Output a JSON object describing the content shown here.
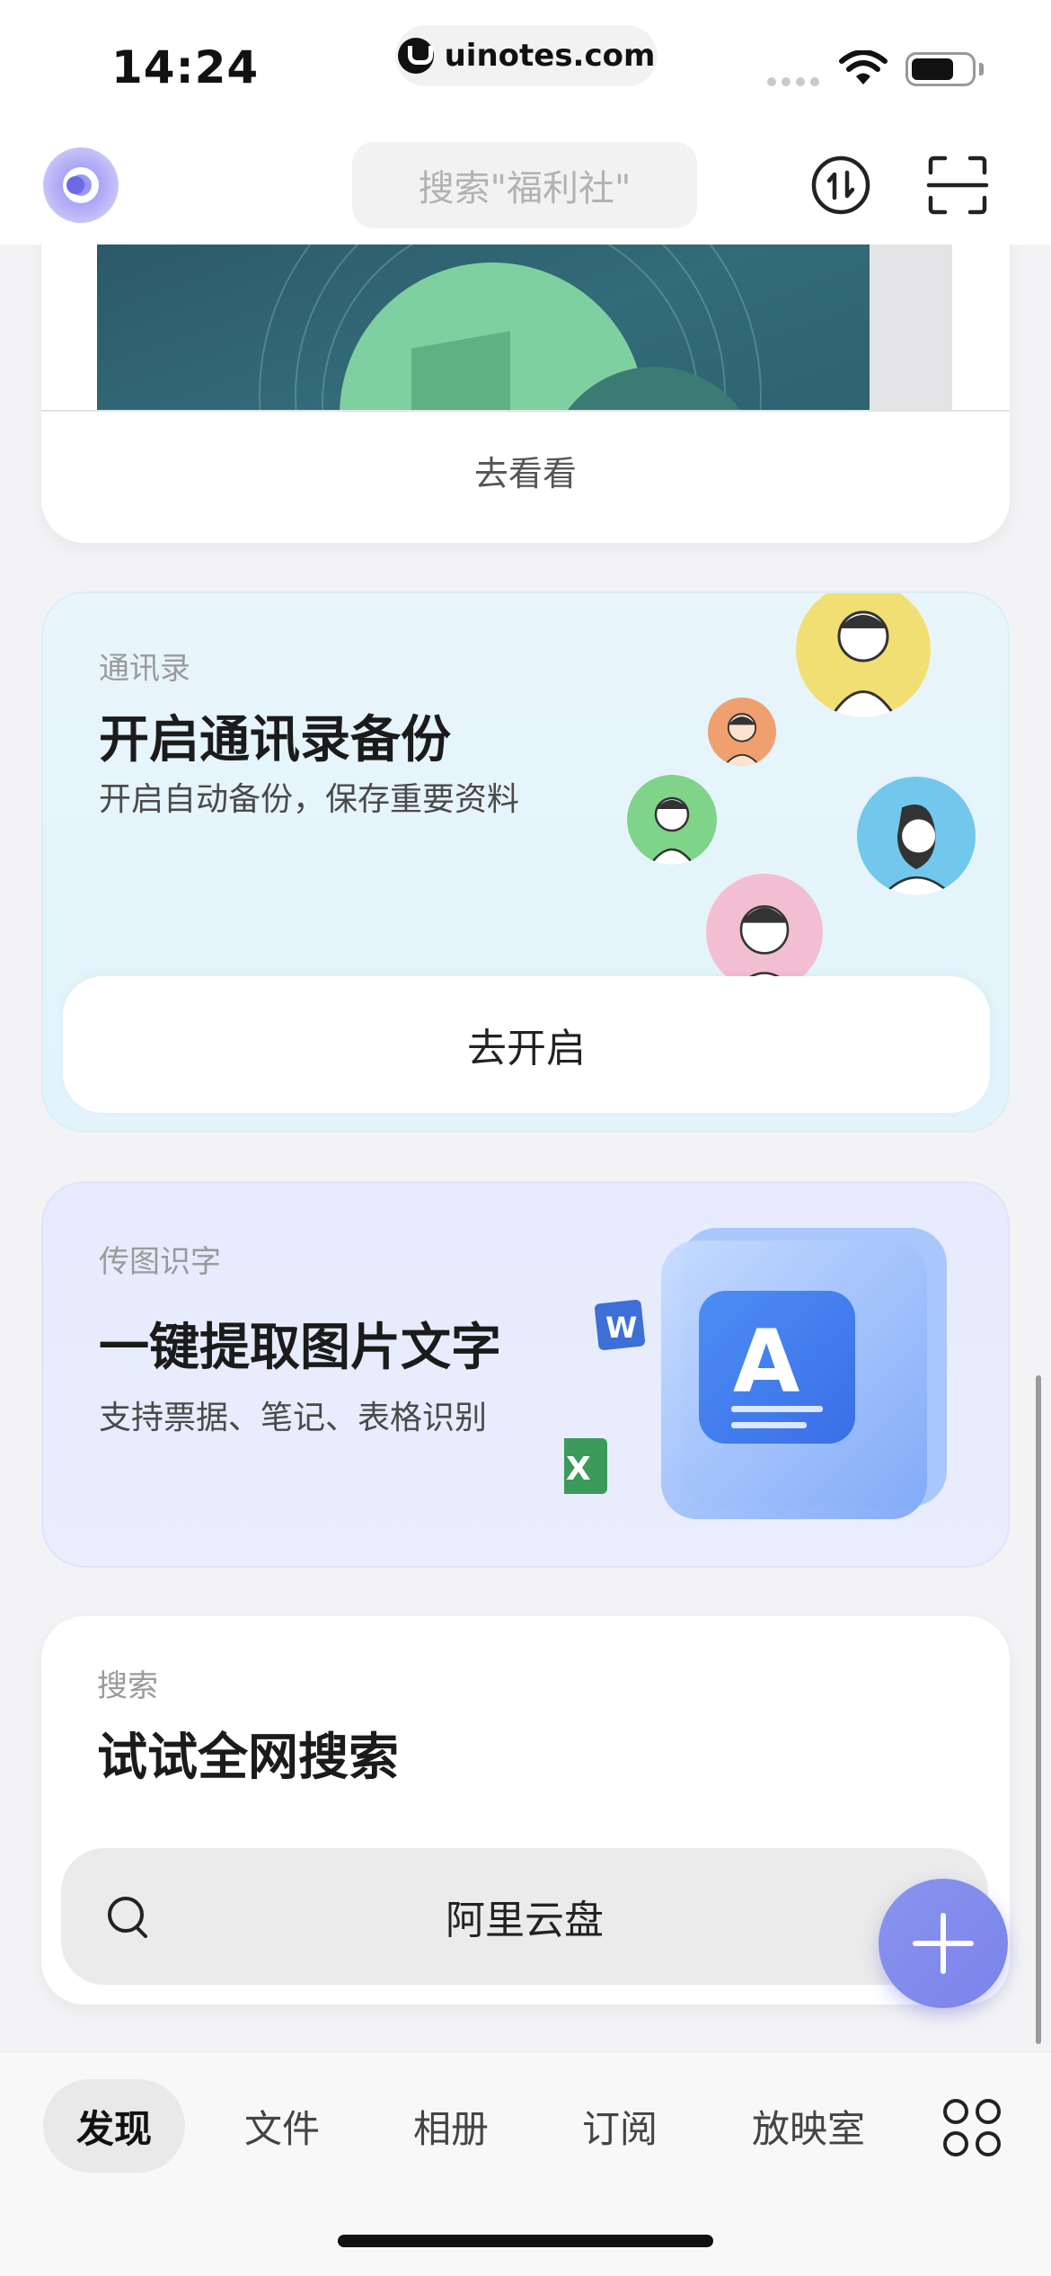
{
  "status_bar": {
    "time": "14:24",
    "url": "uinotes.com",
    "icons": [
      "signal-icon",
      "wifi-icon",
      "battery-icon"
    ]
  },
  "header": {
    "search_placeholder": "搜索\"福利社\"",
    "icons": [
      "app-logo-icon",
      "transfer-icon",
      "scan-icon"
    ]
  },
  "cards": {
    "top": {
      "action_label": "去看看"
    },
    "contacts": {
      "eyebrow": "通讯录",
      "title": "开启通讯录备份",
      "subtitle": "开启自动备份，保存重要资料",
      "button_label": "去开启",
      "avatar_colors": [
        "#f2df74",
        "#f0a06e",
        "#7fd489",
        "#71c8ec",
        "#f2bfd2"
      ]
    },
    "ocr": {
      "eyebrow": "传图识字",
      "title": "一键提取图片文字",
      "subtitle": "支持票据、笔记、表格识别",
      "icons": [
        "word-icon",
        "excel-icon",
        "text-recognition-icon"
      ]
    },
    "search": {
      "eyebrow": "搜索",
      "title": "试试全网搜索",
      "query": "阿里云盘"
    }
  },
  "bottom_nav": {
    "items": [
      {
        "label": "发现",
        "active": true
      },
      {
        "label": "文件",
        "active": false
      },
      {
        "label": "相册",
        "active": false
      },
      {
        "label": "订阅",
        "active": false
      },
      {
        "label": "放映室",
        "active": false
      }
    ],
    "more_icon": "apps-grid-icon"
  },
  "colors": {
    "accent": "#7a84ea",
    "contacts_bg": "#e2f3fb",
    "ocr_bg": "#e6ebfd"
  }
}
